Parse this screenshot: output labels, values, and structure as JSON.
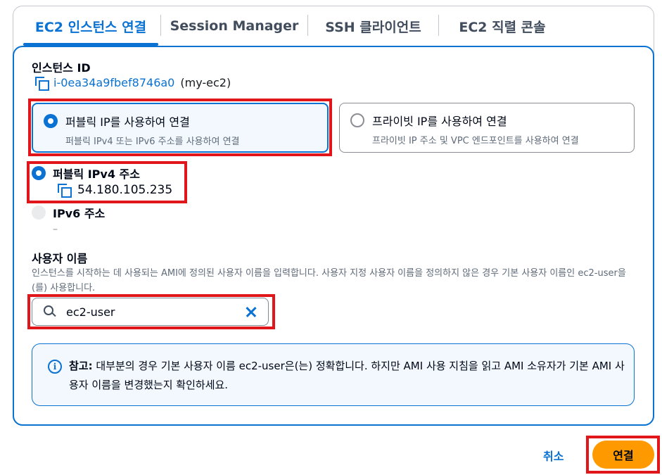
{
  "tabs": [
    {
      "label": "EC2 인스턴스 연결"
    },
    {
      "label": "Session Manager"
    },
    {
      "label": "SSH 클라이언트"
    },
    {
      "label": "EC2 직렬 콘솔"
    }
  ],
  "instance": {
    "label": "인스턴스 ID",
    "id": "i-0ea34a9fbef8746a0",
    "name": "(my-ec2)"
  },
  "connection_type": {
    "public": {
      "title": "퍼블릭 IP를 사용하여 연결",
      "desc": "퍼블릭 IPv4 또는 IPv6 주소를 사용하여 연결",
      "selected": true
    },
    "private": {
      "title": "프라이빗 IP를 사용하여 연결",
      "desc": "프라이빗 IP 주소 및 VPC 엔드포인트를 사용하여 연결",
      "selected": false
    }
  },
  "address": {
    "ipv4_label": "퍼블릭 IPv4 주소",
    "ipv4_value": "54.180.105.235",
    "ipv6_label": "IPv6 주소",
    "ipv6_value": "–"
  },
  "username": {
    "label": "사용자 이름",
    "help": "인스턴스를 시작하는 데 사용되는 AMI에 정의된 사용자 이름을 입력합니다. 사용자 지정 사용자 이름을 정의하지 않은 경우 기본 사용자 이름인 ec2-user을(를) 사용합니다.",
    "value": "ec2-user"
  },
  "alert": {
    "title": "참고:",
    "body": " 대부분의 경우 기본 사용자 이름 ec2-user은(는) 정확합니다. 하지만 AMI 사용 지침을 읽고 AMI 소유자가 기본 AMI 사용자 이름을 변경했는지 확인하세요."
  },
  "actions": {
    "cancel": "취소",
    "connect": "연결"
  },
  "colors": {
    "accent": "#0972d3",
    "primary_button": "#ff9900",
    "highlight": "#e0161b"
  }
}
